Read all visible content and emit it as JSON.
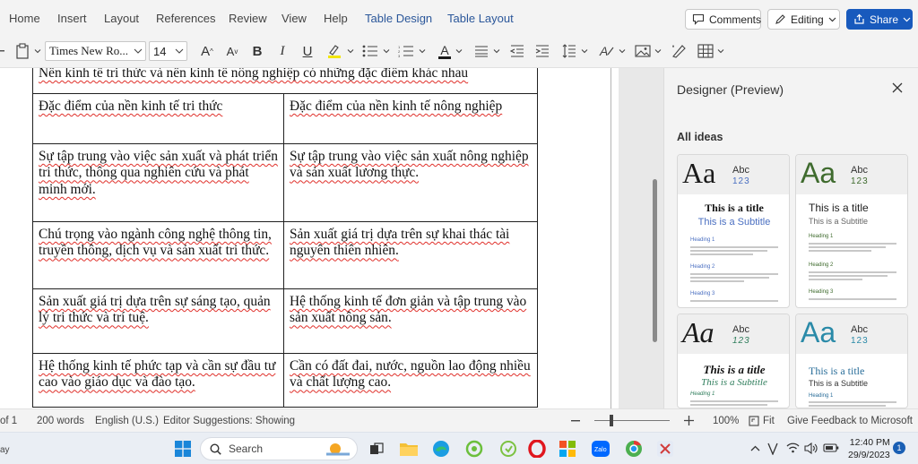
{
  "ribbon": {
    "tabs": [
      "Home",
      "Insert",
      "Layout",
      "References",
      "Review",
      "View",
      "Help",
      "Table Design",
      "Table Layout"
    ],
    "comments_label": "Comments",
    "editing_label": "Editing",
    "share_label": "Share",
    "accent": "#2b579a",
    "share_color": "#185abd"
  },
  "toolbar": {
    "font_name": "Times New Ro...",
    "font_size": "14",
    "icons": [
      "paste-icon",
      "grow-font-icon",
      "shrink-font-icon",
      "bold-icon",
      "italic-icon",
      "underline-icon",
      "highlight-icon",
      "bullets-icon",
      "numbering-icon",
      "font-color-icon",
      "align-icon",
      "decrease-indent-icon",
      "increase-indent-icon",
      "line-spacing-icon",
      "styles-icon",
      "picture-icon",
      "designer-icon",
      "table-icon"
    ]
  },
  "document": {
    "title_row": "Nền kinh tế tri thức và nền kinh tế nông nghiệp có những đặc điểm khác nhau",
    "headers": [
      "Đặc điểm của nền kinh tế tri thức",
      "Đặc điểm của nền kinh tế nông nghiệp"
    ],
    "rows": [
      [
        "Sự tập trung vào việc sản xuất và phát triển tri thức, thông qua nghiên cứu và phát minh mới.",
        "Sự tập trung vào việc sản xuất nông nghiệp và sản xuất lương thực."
      ],
      [
        "Chú trọng vào ngành công nghệ thông tin, truyền thông, dịch vụ và sản xuất tri thức.",
        "Sản xuất giá trị dựa trên sự khai thác tài nguyên thiên nhiên."
      ],
      [
        "Sản xuất giá trị dựa trên sự sáng tạo, quản lý tri thức và trí tuệ.",
        "Hệ thống kinh tế đơn giản và tập trung vào sản xuất nông sản."
      ],
      [
        "Hệ thống kinh tế phức tạp và cần sự đầu tư cao vào giáo dục và đào tạo.",
        "Cần có đất đai, nước, nguồn lao động nhiều và chất lượng cao."
      ]
    ]
  },
  "designer": {
    "title": "Designer (Preview)",
    "section": "All ideas",
    "cards": [
      {
        "big": "Aa",
        "abc": "Abc",
        "nums": "123",
        "title": "This is a title",
        "subtitle": "This is a Subtitle",
        "h1": "Heading 1",
        "h2": "Heading 2",
        "h3": "Heading 3",
        "accent": "#4a6fc1"
      },
      {
        "big": "Aa",
        "abc": "Abc",
        "nums": "123",
        "title": "This is a title",
        "subtitle": "This is a Subtitle",
        "h1": "Heading 1",
        "h2": "Heading 2",
        "h3": "Heading 3",
        "accent": "#3f6b2e"
      },
      {
        "big": "Aa",
        "abc": "Abc",
        "nums": "123",
        "title": "This is a title",
        "subtitle": "This is a Subtitle",
        "h1": "Heading 1",
        "accent": "#2e7d5b"
      },
      {
        "big": "Aa",
        "abc": "Abc",
        "nums": "123",
        "title": "This is a title",
        "subtitle": "This is a Subtitle",
        "h1": "Heading 1",
        "accent": "#2a8aa8"
      }
    ]
  },
  "statusbar": {
    "page": "of 1",
    "words": "200 words",
    "language": "English (U.S.)",
    "editor": "Editor Suggestions: Showing",
    "zoom": "100%",
    "fit": "Fit",
    "feedback": "Give Feedback to Microsoft",
    "cut_left": "ay"
  },
  "taskbar": {
    "search_label": "Search",
    "time": "12:40 PM",
    "date": "29/9/2023",
    "notification_count": "1",
    "apps": [
      "start-icon",
      "search-icon",
      "task-view-icon",
      "file-explorer-icon",
      "edge-icon",
      "app-icon",
      "opera-icon",
      "store-icon",
      "zalo-icon",
      "chrome-icon",
      "snipping-tool-icon"
    ]
  }
}
